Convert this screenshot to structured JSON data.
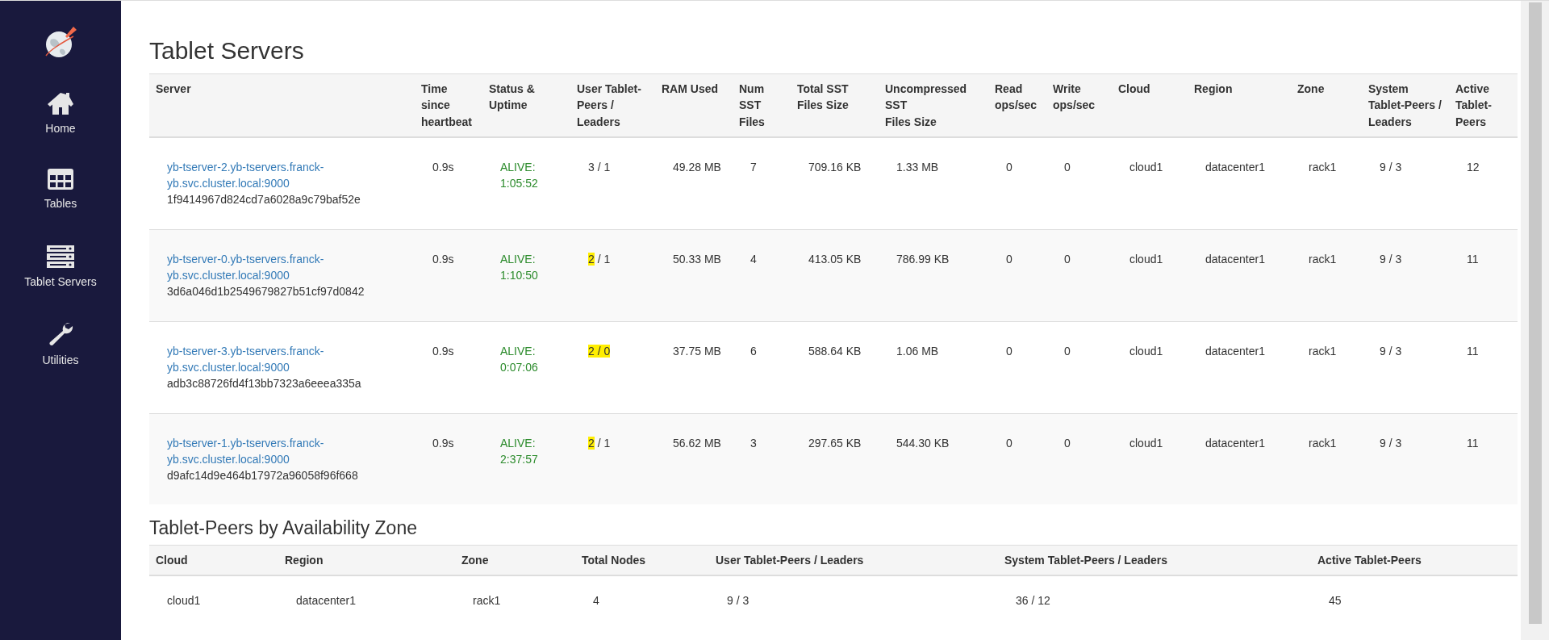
{
  "sidebar": {
    "items": [
      {
        "kind": "home",
        "label": "Home"
      },
      {
        "kind": "tables",
        "label": "Tables"
      },
      {
        "kind": "servers",
        "label": "Tablet Servers"
      },
      {
        "kind": "utilities",
        "label": "Utilities"
      }
    ]
  },
  "tablet_servers": {
    "title": "Tablet Servers",
    "columns": [
      "Server",
      "Time since heartbeat",
      "Status & Uptime",
      "User Tablet-Peers / Leaders",
      "RAM Used",
      "Num SST Files",
      "Total SST Files Size",
      "Uncompressed\nSST\nFiles Size",
      "Read ops/sec",
      "Write ops/sec",
      "Cloud",
      "Region",
      "Zone",
      "System Tablet-Peers / Leaders",
      "Active Tablet-Peers"
    ],
    "rows": [
      {
        "server": "yb-tserver-2.yb-tservers.franck-yb.svc.cluster.local:9000",
        "uuid": "1f9414967d824cd7a6028a9c79baf52e",
        "heartbeat": "0.9s",
        "status": "ALIVE:",
        "uptime": "1:05:52",
        "user_peers": [
          {
            "text": "3 / 1",
            "highlighted": false
          }
        ],
        "ram": "49.28 MB",
        "sst_files": "7",
        "sst_size": "709.16 KB",
        "uncompressed": "1.33 MB",
        "read": "0",
        "write": "0",
        "cloud": "cloud1",
        "region": "datacenter1",
        "zone": "rack1",
        "system_peers": "9 / 3",
        "active_peers": "12"
      },
      {
        "server": "yb-tserver-0.yb-tservers.franck-yb.svc.cluster.local:9000",
        "uuid": "3d6a046d1b2549679827b51cf97d0842",
        "heartbeat": "0.9s",
        "status": "ALIVE:",
        "uptime": "1:10:50",
        "user_peers": [
          {
            "text": "2",
            "highlighted": true
          },
          {
            "text": " / 1",
            "highlighted": false
          }
        ],
        "ram": "50.33 MB",
        "sst_files": "4",
        "sst_size": "413.05 KB",
        "uncompressed": "786.99 KB",
        "read": "0",
        "write": "0",
        "cloud": "cloud1",
        "region": "datacenter1",
        "zone": "rack1",
        "system_peers": "9 / 3",
        "active_peers": "11"
      },
      {
        "server": "yb-tserver-3.yb-tservers.franck-yb.svc.cluster.local:9000",
        "uuid": "adb3c88726fd4f13bb7323a6eeea335a",
        "heartbeat": "0.9s",
        "status": "ALIVE:",
        "uptime": "0:07:06",
        "user_peers": [
          {
            "text": "2 / 0",
            "highlighted": true
          }
        ],
        "ram": "37.75 MB",
        "sst_files": "6",
        "sst_size": "588.64 KB",
        "uncompressed": "1.06 MB",
        "read": "0",
        "write": "0",
        "cloud": "cloud1",
        "region": "datacenter1",
        "zone": "rack1",
        "system_peers": "9 / 3",
        "active_peers": "11"
      },
      {
        "server": "yb-tserver-1.yb-tservers.franck-yb.svc.cluster.local:9000",
        "uuid": "d9afc14d9e464b17972a96058f96f668",
        "heartbeat": "0.9s",
        "status": "ALIVE:",
        "uptime": "2:37:57",
        "user_peers": [
          {
            "text": "2",
            "highlighted": true
          },
          {
            "text": " / 1",
            "highlighted": false
          }
        ],
        "ram": "56.62 MB",
        "sst_files": "3",
        "sst_size": "297.65 KB",
        "uncompressed": "544.30 KB",
        "read": "0",
        "write": "0",
        "cloud": "cloud1",
        "region": "datacenter1",
        "zone": "rack1",
        "system_peers": "9 / 3",
        "active_peers": "11"
      }
    ]
  },
  "zones": {
    "title": "Tablet-Peers by Availability Zone",
    "columns": [
      "Cloud",
      "Region",
      "Zone",
      "Total Nodes",
      "User Tablet-Peers / Leaders",
      "System Tablet-Peers / Leaders",
      "Active Tablet-Peers"
    ],
    "rows": [
      [
        "cloud1",
        "datacenter1",
        "rack1",
        "4",
        "9 / 3",
        "36 / 12",
        "45"
      ]
    ]
  }
}
